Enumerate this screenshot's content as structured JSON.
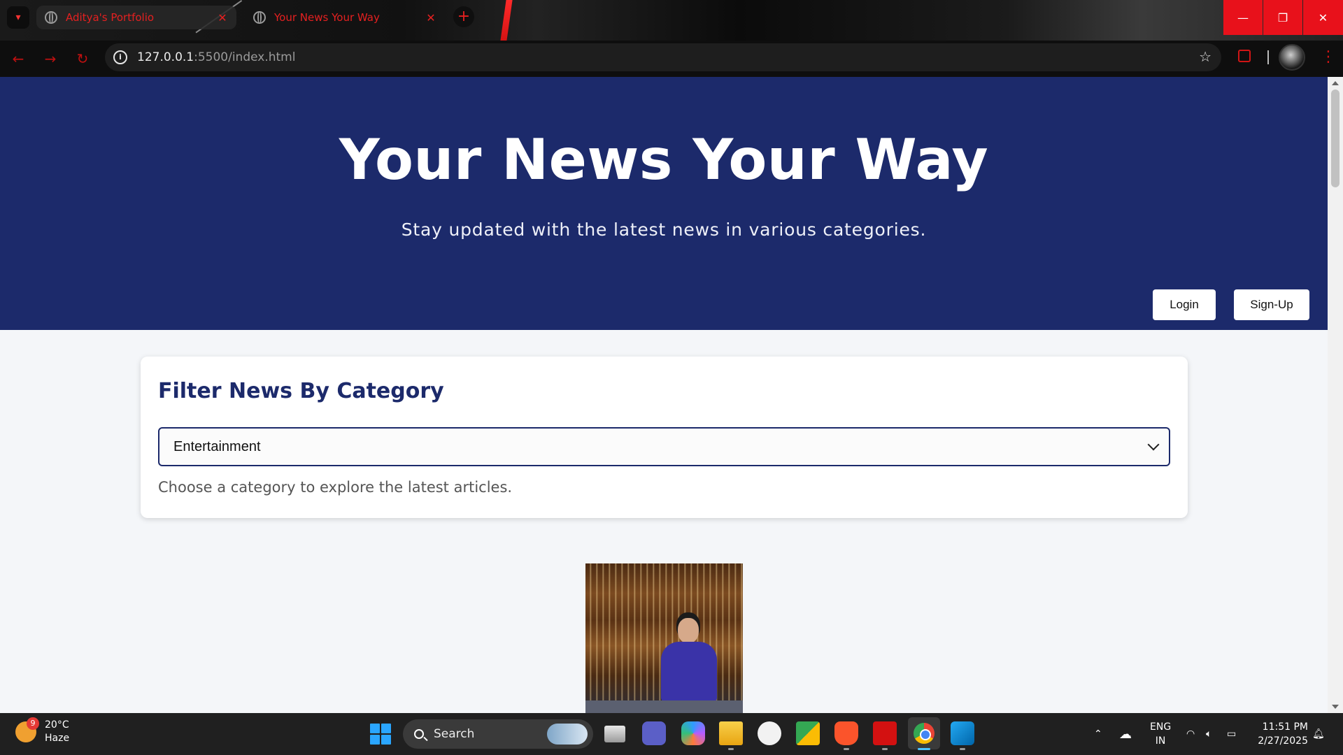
{
  "browser": {
    "tabs": [
      {
        "title": "Aditya's Portfolio",
        "active": false
      },
      {
        "title": "Your News Your Way",
        "active": true
      }
    ],
    "url_host": "127.0.0.1",
    "url_rest": ":5500/index.html",
    "accent_color": "#e52020"
  },
  "page": {
    "hero": {
      "title": "Your News Your Way",
      "subtitle": "Stay updated with the latest news in various categories.",
      "login_label": "Login",
      "signup_label": "Sign-Up",
      "bg_color": "#1c2a6b"
    },
    "filter": {
      "heading": "Filter News By Category",
      "selected_category": "Entertainment",
      "hint": "Choose a category to explore the latest articles."
    }
  },
  "taskbar": {
    "weather_temp": "20°C",
    "weather_desc": "Haze",
    "weather_badge": "9",
    "search_label": "Search",
    "lang_line1": "ENG",
    "lang_line2": "IN",
    "time": "11:51 PM",
    "date": "2/27/2025",
    "apps": [
      "task-view",
      "teams",
      "copilot",
      "file-explorer",
      "github",
      "meet",
      "brave",
      "acrobat",
      "chrome",
      "vscode"
    ]
  }
}
